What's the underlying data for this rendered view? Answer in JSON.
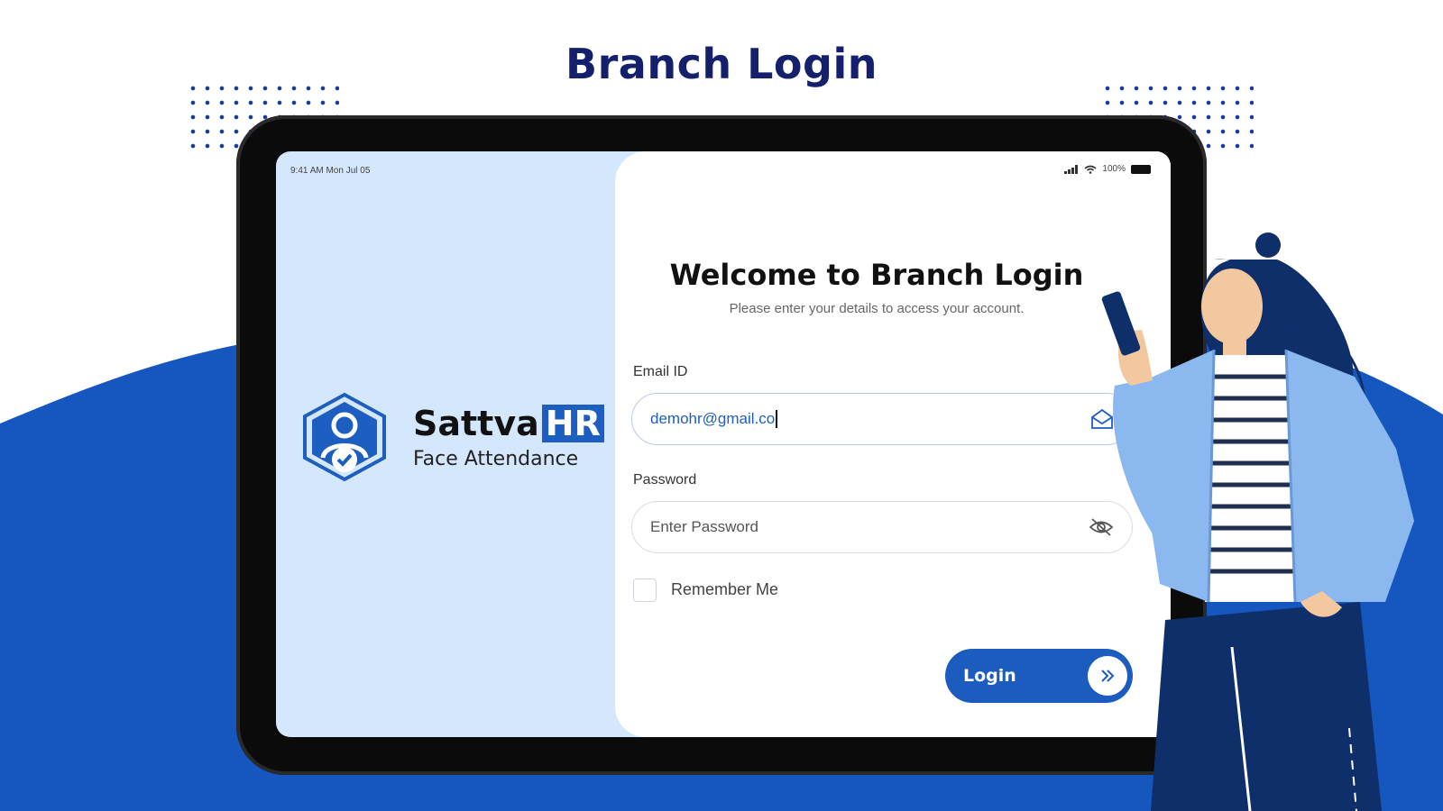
{
  "page": {
    "title": "Branch Login"
  },
  "status_bar": {
    "time_date": "9:41 AM  Mon Jul 05",
    "battery": "100%"
  },
  "branding": {
    "brand_name": "Sattva",
    "brand_suffix": "HR",
    "tagline": "Face Attendance"
  },
  "login_form": {
    "heading": "Welcome to Branch Login",
    "subtitle": "Please enter your details to access your account.",
    "email_label": "Email ID",
    "email_value": "demohr@gmail.co",
    "password_label": "Password",
    "password_placeholder": "Enter Password",
    "remember_label": "Remember Me",
    "login_button": "Login"
  },
  "colors": {
    "primary": "#1b5cbe",
    "title": "#14206b",
    "panel_bg": "#d4e7fd",
    "wave": "#1557bf"
  }
}
